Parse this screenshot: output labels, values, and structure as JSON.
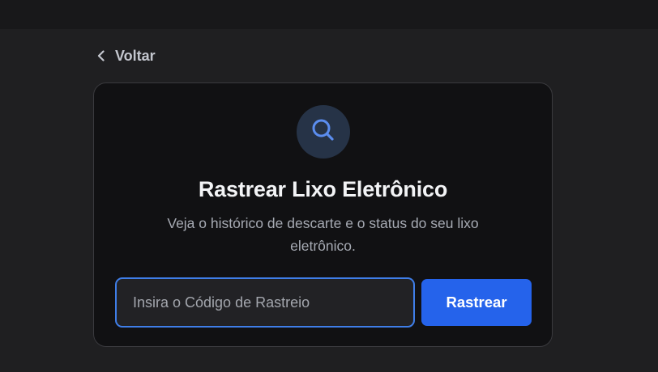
{
  "header": {
    "back_label": "Voltar"
  },
  "tracker": {
    "icon": "search-icon",
    "title": "Rastrear Lixo Eletrônico",
    "subtitle": "Veja o histórico de descarte e o status do seu lixo eletrônico.",
    "input_placeholder": "Insira o Código de Rastreio",
    "input_value": "",
    "button_label": "Rastrear"
  },
  "colors": {
    "accent": "#2563eb",
    "input_border": "#3f7ee8",
    "icon_color": "#5b8def",
    "icon_bg": "#263347",
    "card_bg": "#111113",
    "page_bg": "#1f1f21"
  }
}
